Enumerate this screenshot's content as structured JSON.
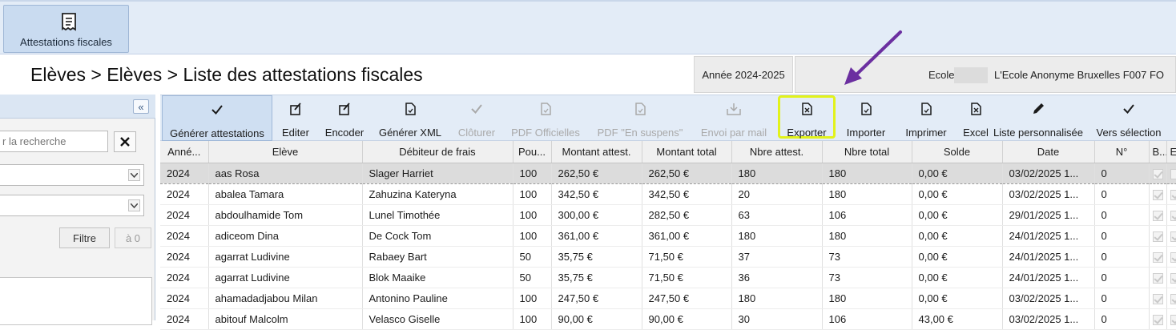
{
  "ribbon": {
    "button_label": "Attestations fiscales",
    "button_icon": "receipt-icon"
  },
  "header": {
    "breadcrumb": "Elèves > Elèves > Liste des attestations fiscales",
    "year": "Année 2024-2025",
    "school_label": "Ecole",
    "school_name": "L'Ecole Anonyme Bruxelles F007 FO"
  },
  "left_panel": {
    "collapse_symbol": "«",
    "search_placeholder": "r la recherche",
    "filter_label": "Filtre",
    "reset_label": "à 0"
  },
  "toolbar": [
    {
      "label": "Générer attestations",
      "icon": "check-icon",
      "state": "active"
    },
    {
      "label": "Editer",
      "icon": "edit-icon",
      "state": "normal"
    },
    {
      "label": "Encoder",
      "icon": "edit-icon",
      "state": "normal"
    },
    {
      "label": "Générer XML",
      "icon": "document-icon",
      "state": "normal"
    },
    {
      "label": "Clôturer",
      "icon": "check-icon",
      "state": "disabled"
    },
    {
      "label": "PDF Officielles",
      "icon": "document-icon",
      "state": "disabled"
    },
    {
      "label": "PDF \"En suspens\"",
      "icon": "document-icon",
      "state": "disabled"
    },
    {
      "label": "Envoi par mail",
      "icon": "inbox-icon",
      "state": "disabled"
    },
    {
      "label": "Exporter",
      "icon": "excel-icon",
      "state": "highlight"
    },
    {
      "label": "Importer",
      "icon": "document-icon",
      "state": "normal"
    },
    {
      "label": "Imprimer",
      "icon": "document-icon",
      "state": "normal"
    },
    {
      "label": "Excel",
      "icon": "excel-icon",
      "state": "normal"
    },
    {
      "label": "Liste personnalisée",
      "icon": "pencil-icon",
      "state": "normal"
    },
    {
      "label": "Vers sélection",
      "icon": "check-icon",
      "state": "normal"
    }
  ],
  "table": {
    "columns": [
      "Anné...",
      "Elève",
      "Débiteur de frais",
      "Pou...",
      "Montant attest.",
      "Montant total",
      "Nbre attest.",
      "Nbre total",
      "Solde",
      "Date",
      "N°",
      "B...",
      "E..."
    ],
    "rows": [
      {
        "year": "2024",
        "student": "aas Rosa",
        "debtor": "Slager Harriet",
        "pct": "100",
        "amount_att": "262,50 €",
        "amount_total": "262,50 €",
        "nb_att": "180",
        "nb_total": "180",
        "balance": "0,00 €",
        "date": "03/02/2025 1...",
        "num": "0",
        "b": true,
        "e": false,
        "selected": true
      },
      {
        "year": "2024",
        "student": "abalea Tamara",
        "debtor": "Zahuzina Kateryna",
        "pct": "100",
        "amount_att": "342,50 €",
        "amount_total": "342,50 €",
        "nb_att": "20",
        "nb_total": "180",
        "balance": "0,00 €",
        "date": "03/02/2025 1...",
        "num": "0",
        "b": true,
        "e": true,
        "selected": false
      },
      {
        "year": "2024",
        "student": "abdoulhamide Tom",
        "debtor": "Lunel Timothée",
        "pct": "100",
        "amount_att": "300,00 €",
        "amount_total": "282,50 €",
        "nb_att": "63",
        "nb_total": "106",
        "balance": "0,00 €",
        "date": "29/01/2025 1...",
        "num": "0",
        "b": true,
        "e": true,
        "selected": false
      },
      {
        "year": "2024",
        "student": "adiceom Dina",
        "debtor": "De Cock Tom",
        "pct": "100",
        "amount_att": "361,00 €",
        "amount_total": "361,00 €",
        "nb_att": "180",
        "nb_total": "180",
        "balance": "0,00 €",
        "date": "24/01/2025 1...",
        "num": "0",
        "b": true,
        "e": true,
        "selected": false
      },
      {
        "year": "2024",
        "student": "agarrat Ludivine",
        "debtor": "Rabaey Bart",
        "pct": "50",
        "amount_att": "35,75 €",
        "amount_total": "71,50 €",
        "nb_att": "37",
        "nb_total": "73",
        "balance": "0,00 €",
        "date": "24/01/2025 1...",
        "num": "0",
        "b": true,
        "e": true,
        "selected": false
      },
      {
        "year": "2024",
        "student": "agarrat Ludivine",
        "debtor": "Blok Maaike",
        "pct": "50",
        "amount_att": "35,75 €",
        "amount_total": "71,50 €",
        "nb_att": "36",
        "nb_total": "73",
        "balance": "0,00 €",
        "date": "24/01/2025 1...",
        "num": "0",
        "b": true,
        "e": true,
        "selected": false
      },
      {
        "year": "2024",
        "student": "ahamadadjabou Milan",
        "debtor": "Antonino Pauline",
        "pct": "100",
        "amount_att": "247,50 €",
        "amount_total": "247,50 €",
        "nb_att": "180",
        "nb_total": "180",
        "balance": "0,00 €",
        "date": "03/02/2025 1...",
        "num": "0",
        "b": true,
        "e": true,
        "selected": false
      },
      {
        "year": "2024",
        "student": "abitouf Malcolm",
        "debtor": "Velasco Giselle",
        "pct": "100",
        "amount_att": "90,00 €",
        "amount_total": "90,00 €",
        "nb_att": "30",
        "nb_total": "106",
        "balance": "43,00 €",
        "date": "03/02/2025 1...",
        "num": "0",
        "b": true,
        "e": true,
        "selected": false
      }
    ]
  },
  "colors": {
    "ribbon_bg": "#e3ecf7",
    "highlight": "#e2f21b",
    "arrow": "#6b2fa0"
  }
}
